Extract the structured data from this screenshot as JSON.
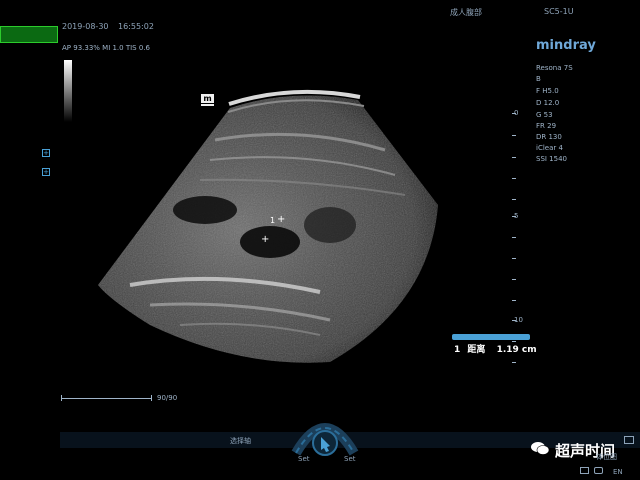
{
  "header": {
    "date": "2019-08-30",
    "time": "16:55:02",
    "exam": "成人腹部",
    "probe": "SC5-1U",
    "indices": "AP 93.33%  MI 1.0  TIS 0.6"
  },
  "brand": {
    "name": "mindray",
    "model": "Resona 7S",
    "mode": "B"
  },
  "params": [
    "F H5.0",
    "D 12.0",
    "G 53",
    "FR 29",
    "DR 130",
    "iClear 4",
    "SSI 1540"
  ],
  "depth_scale": {
    "top": "0",
    "mid": "5",
    "bottom": "10"
  },
  "marker": {
    "caliper_label": "1",
    "cross": "+"
  },
  "measurement": {
    "index": "1",
    "label": "距离",
    "value": "1.19 cm"
  },
  "slider": {
    "value": "90/90"
  },
  "bottom": {
    "label": "选择轴",
    "set_left": "Set",
    "set_right": "Set",
    "right_label": "体位图",
    "lang": "EN"
  },
  "watermark": {
    "text": "超声时间"
  },
  "colors": {
    "accent": "#4aa1d6",
    "green": "#0b6a12"
  }
}
